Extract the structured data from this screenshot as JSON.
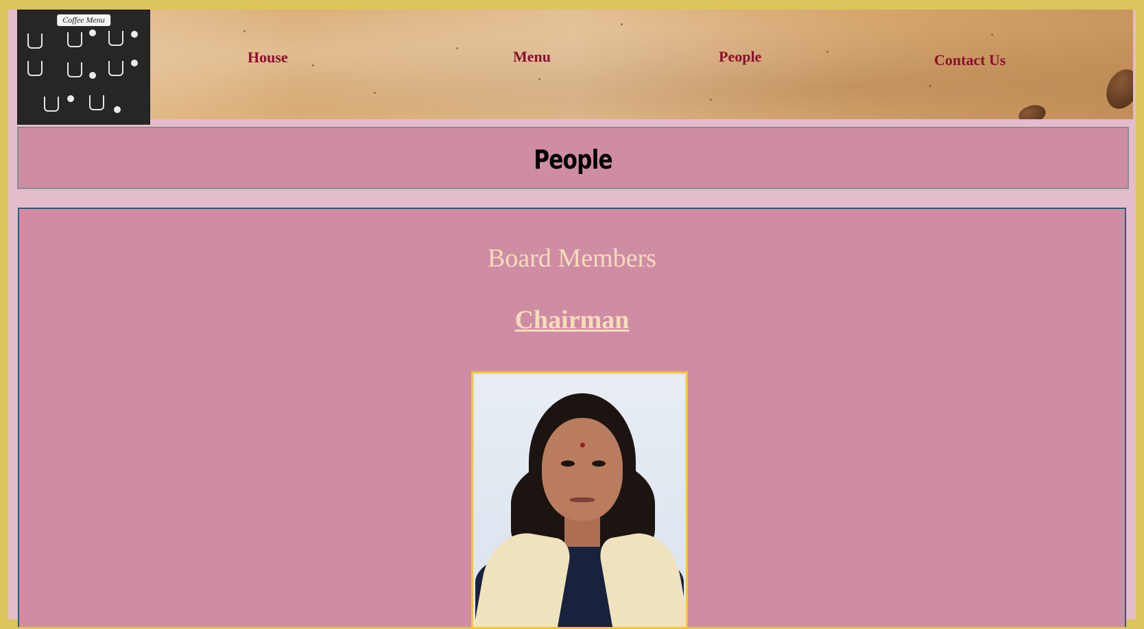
{
  "logo": {
    "title": "Coffee Menu"
  },
  "nav": {
    "items": [
      {
        "label": "House"
      },
      {
        "label": "Menu"
      },
      {
        "label": "People"
      },
      {
        "label": "Contact Us"
      }
    ]
  },
  "page": {
    "title": "People"
  },
  "content": {
    "section_heading": "Board Members",
    "role_heading": "Chairman"
  },
  "colors": {
    "outer_border": "#dcc55a",
    "background": "#e4bccb",
    "panel": "#cf8da4",
    "nav_text": "#8b0f2e",
    "heading_text": "#f8dcbc",
    "photo_border": "#f5c531"
  }
}
